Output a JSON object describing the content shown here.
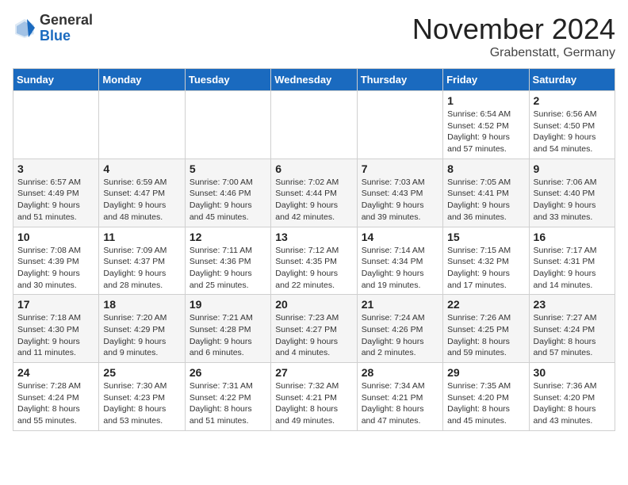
{
  "logo": {
    "general": "General",
    "blue": "Blue"
  },
  "header": {
    "month": "November 2024",
    "location": "Grabenstatt, Germany"
  },
  "weekdays": [
    "Sunday",
    "Monday",
    "Tuesday",
    "Wednesday",
    "Thursday",
    "Friday",
    "Saturday"
  ],
  "weeks": [
    [
      {
        "day": "",
        "info": ""
      },
      {
        "day": "",
        "info": ""
      },
      {
        "day": "",
        "info": ""
      },
      {
        "day": "",
        "info": ""
      },
      {
        "day": "",
        "info": ""
      },
      {
        "day": "1",
        "info": "Sunrise: 6:54 AM\nSunset: 4:52 PM\nDaylight: 9 hours and 57 minutes."
      },
      {
        "day": "2",
        "info": "Sunrise: 6:56 AM\nSunset: 4:50 PM\nDaylight: 9 hours and 54 minutes."
      }
    ],
    [
      {
        "day": "3",
        "info": "Sunrise: 6:57 AM\nSunset: 4:49 PM\nDaylight: 9 hours and 51 minutes."
      },
      {
        "day": "4",
        "info": "Sunrise: 6:59 AM\nSunset: 4:47 PM\nDaylight: 9 hours and 48 minutes."
      },
      {
        "day": "5",
        "info": "Sunrise: 7:00 AM\nSunset: 4:46 PM\nDaylight: 9 hours and 45 minutes."
      },
      {
        "day": "6",
        "info": "Sunrise: 7:02 AM\nSunset: 4:44 PM\nDaylight: 9 hours and 42 minutes."
      },
      {
        "day": "7",
        "info": "Sunrise: 7:03 AM\nSunset: 4:43 PM\nDaylight: 9 hours and 39 minutes."
      },
      {
        "day": "8",
        "info": "Sunrise: 7:05 AM\nSunset: 4:41 PM\nDaylight: 9 hours and 36 minutes."
      },
      {
        "day": "9",
        "info": "Sunrise: 7:06 AM\nSunset: 4:40 PM\nDaylight: 9 hours and 33 minutes."
      }
    ],
    [
      {
        "day": "10",
        "info": "Sunrise: 7:08 AM\nSunset: 4:39 PM\nDaylight: 9 hours and 30 minutes."
      },
      {
        "day": "11",
        "info": "Sunrise: 7:09 AM\nSunset: 4:37 PM\nDaylight: 9 hours and 28 minutes."
      },
      {
        "day": "12",
        "info": "Sunrise: 7:11 AM\nSunset: 4:36 PM\nDaylight: 9 hours and 25 minutes."
      },
      {
        "day": "13",
        "info": "Sunrise: 7:12 AM\nSunset: 4:35 PM\nDaylight: 9 hours and 22 minutes."
      },
      {
        "day": "14",
        "info": "Sunrise: 7:14 AM\nSunset: 4:34 PM\nDaylight: 9 hours and 19 minutes."
      },
      {
        "day": "15",
        "info": "Sunrise: 7:15 AM\nSunset: 4:32 PM\nDaylight: 9 hours and 17 minutes."
      },
      {
        "day": "16",
        "info": "Sunrise: 7:17 AM\nSunset: 4:31 PM\nDaylight: 9 hours and 14 minutes."
      }
    ],
    [
      {
        "day": "17",
        "info": "Sunrise: 7:18 AM\nSunset: 4:30 PM\nDaylight: 9 hours and 11 minutes."
      },
      {
        "day": "18",
        "info": "Sunrise: 7:20 AM\nSunset: 4:29 PM\nDaylight: 9 hours and 9 minutes."
      },
      {
        "day": "19",
        "info": "Sunrise: 7:21 AM\nSunset: 4:28 PM\nDaylight: 9 hours and 6 minutes."
      },
      {
        "day": "20",
        "info": "Sunrise: 7:23 AM\nSunset: 4:27 PM\nDaylight: 9 hours and 4 minutes."
      },
      {
        "day": "21",
        "info": "Sunrise: 7:24 AM\nSunset: 4:26 PM\nDaylight: 9 hours and 2 minutes."
      },
      {
        "day": "22",
        "info": "Sunrise: 7:26 AM\nSunset: 4:25 PM\nDaylight: 8 hours and 59 minutes."
      },
      {
        "day": "23",
        "info": "Sunrise: 7:27 AM\nSunset: 4:24 PM\nDaylight: 8 hours and 57 minutes."
      }
    ],
    [
      {
        "day": "24",
        "info": "Sunrise: 7:28 AM\nSunset: 4:24 PM\nDaylight: 8 hours and 55 minutes."
      },
      {
        "day": "25",
        "info": "Sunrise: 7:30 AM\nSunset: 4:23 PM\nDaylight: 8 hours and 53 minutes."
      },
      {
        "day": "26",
        "info": "Sunrise: 7:31 AM\nSunset: 4:22 PM\nDaylight: 8 hours and 51 minutes."
      },
      {
        "day": "27",
        "info": "Sunrise: 7:32 AM\nSunset: 4:21 PM\nDaylight: 8 hours and 49 minutes."
      },
      {
        "day": "28",
        "info": "Sunrise: 7:34 AM\nSunset: 4:21 PM\nDaylight: 8 hours and 47 minutes."
      },
      {
        "day": "29",
        "info": "Sunrise: 7:35 AM\nSunset: 4:20 PM\nDaylight: 8 hours and 45 minutes."
      },
      {
        "day": "30",
        "info": "Sunrise: 7:36 AM\nSunset: 4:20 PM\nDaylight: 8 hours and 43 minutes."
      }
    ]
  ]
}
